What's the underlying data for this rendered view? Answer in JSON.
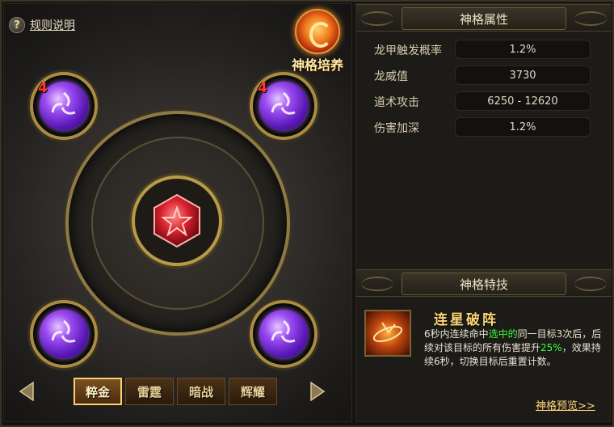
{
  "left": {
    "rules_icon": "question-icon",
    "rules_label": "规则说明",
    "cultivate_label": "神格培养",
    "orbs": [
      {
        "position": "top-left",
        "level": "4"
      },
      {
        "position": "top-right",
        "level": "4"
      },
      {
        "position": "bottom-left",
        "level": ""
      },
      {
        "position": "bottom-right",
        "level": ""
      }
    ],
    "tabs": [
      {
        "label": "粹金",
        "active": true
      },
      {
        "label": "雷霆",
        "active": false
      },
      {
        "label": "暗战",
        "active": false
      },
      {
        "label": "辉耀",
        "active": false
      }
    ]
  },
  "attributes": {
    "title": "神格属性",
    "rows": [
      {
        "name": "龙甲触发概率",
        "value": "1.2%"
      },
      {
        "name": "龙威值",
        "value": "3730"
      },
      {
        "name": "道术攻击",
        "value": "6250 - 12620"
      },
      {
        "name": "伤害加深",
        "value": "1.2%"
      }
    ]
  },
  "skill": {
    "title": "神格特技",
    "name": "连星破阵",
    "desc_1": "6秒内连续命中",
    "desc_hl1": "选中的",
    "desc_2": "同一目标3次后，后续对该目标的所有伤害提升",
    "desc_hl2": "25%",
    "desc_3": "，效果持续6秒，切换目标后重置计数。",
    "preview_label": "神格预览>>"
  },
  "colors": {
    "accent_gold": "#d9a23a",
    "orb_purple": "#9b4cf0",
    "gem_red": "#c81e2a",
    "highlight_green": "#3cff3c",
    "level_red": "#ff3a2a"
  }
}
